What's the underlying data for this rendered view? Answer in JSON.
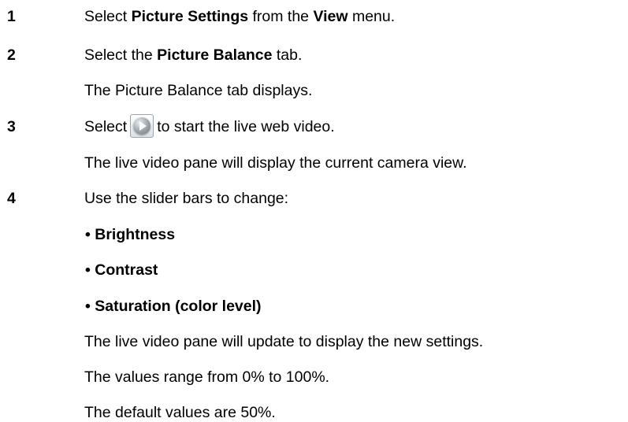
{
  "steps": [
    {
      "number": "1",
      "parts": [
        "Select ",
        "Picture Settings",
        " from the ",
        "View",
        " menu."
      ]
    },
    {
      "number": "2",
      "parts": [
        "Select the ",
        "Picture Balance",
        " tab."
      ],
      "result": "The Picture Balance tab displays."
    },
    {
      "number": "3",
      "before": "Select",
      "icon": "play-icon",
      "after": "to start the live web video.",
      "result": "The live video pane will display the current camera view."
    },
    {
      "number": "4",
      "text": "Use the slider bars to change:",
      "bullets": [
        "• Brightness",
        "• Contrast",
        "• Saturation (color level)"
      ],
      "notes": [
        "The live video pane will update to display the new settings.",
        "The values range from 0% to 100%.",
        "The default values are 50%."
      ]
    }
  ]
}
